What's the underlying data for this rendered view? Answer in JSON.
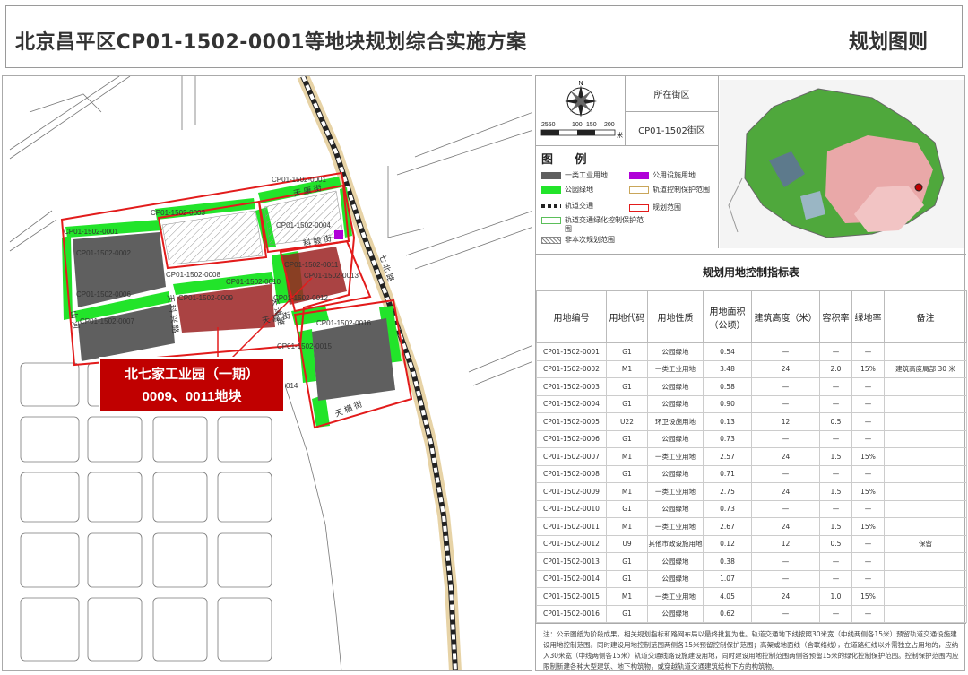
{
  "header": {
    "title": "北京昌平区CP01-1502-0001等地块规划综合实施方案",
    "right": "规划图则"
  },
  "colors": {
    "industrial": "#5f5f5f",
    "green": "#22e42a",
    "public": "#b000d8",
    "boundary": "#e21b1b",
    "highlight": "#9b2222",
    "label_bg": "#c00000"
  },
  "map": {
    "callout": [
      "北七家工业园（一期）",
      "0009、0011地块"
    ],
    "parcel_labels": [
      "CP01-1502-0001",
      "CP01-1502-0002",
      "CP01-1502-0003",
      "CP01-1502-0004",
      "CP01-1502-0005",
      "CP01-1502-0006",
      "CP01-1502-0007",
      "CP01-1502-0008",
      "CP01-1502-0009",
      "CP01-1502-0010",
      "CP01-1502-0011",
      "CP01-1502-0012",
      "CP01-1502-0013",
      "CP01-1502-0015",
      "CP01-1502-0016",
      "02-0014"
    ],
    "road_labels": {
      "tiankang": "天 康 街",
      "keyi": "科 毅 街",
      "kexing": "天 科 兴 路",
      "tianjin": "天 津 路",
      "shanhe": "山 河",
      "tianjiajie": "天 嘉 街",
      "qibei": "七 北 路",
      "tianheng": "天 横 街"
    }
  },
  "compass": {
    "north": "N",
    "scale": [
      "2550",
      "100",
      "150",
      "200"
    ],
    "unit": "米"
  },
  "district": {
    "label": "所在街区",
    "value": "CP01-1502街区"
  },
  "legend": {
    "title": "图 例",
    "items": {
      "industrial": "一类工业用地",
      "public": "公用设施用地",
      "park": "公园绿地",
      "rail_protect": "轨道控制保护范围",
      "rail": "轨道交通",
      "boundary": "规划范围",
      "green_protect": "轨道交通绿化控制保护范围",
      "excluded": "非本次规划范围"
    }
  },
  "table": {
    "title": "规划用地控制指标表",
    "headers": [
      "用地编号",
      "用地代码",
      "用地性质",
      "用地面积（公顷）",
      "建筑高度（米）",
      "容积率",
      "绿地率",
      "备注"
    ],
    "rows": [
      [
        "CP01-1502-0001",
        "G1",
        "公园绿地",
        "0.54",
        "—",
        "—",
        "—",
        ""
      ],
      [
        "CP01-1502-0002",
        "M1",
        "一类工业用地",
        "3.48",
        "24",
        "2.0",
        "15%",
        "建筑高度局部 30 米"
      ],
      [
        "CP01-1502-0003",
        "G1",
        "公园绿地",
        "0.58",
        "—",
        "—",
        "—",
        ""
      ],
      [
        "CP01-1502-0004",
        "G1",
        "公园绿地",
        "0.90",
        "—",
        "—",
        "—",
        ""
      ],
      [
        "CP01-1502-0005",
        "U22",
        "环卫设施用地",
        "0.13",
        "12",
        "0.5",
        "—",
        ""
      ],
      [
        "CP01-1502-0006",
        "G1",
        "公园绿地",
        "0.73",
        "—",
        "—",
        "—",
        ""
      ],
      [
        "CP01-1502-0007",
        "M1",
        "一类工业用地",
        "2.57",
        "24",
        "1.5",
        "15%",
        ""
      ],
      [
        "CP01-1502-0008",
        "G1",
        "公园绿地",
        "0.71",
        "—",
        "—",
        "—",
        ""
      ],
      [
        "CP01-1502-0009",
        "M1",
        "一类工业用地",
        "2.75",
        "24",
        "1.5",
        "15%",
        ""
      ],
      [
        "CP01-1502-0010",
        "G1",
        "公园绿地",
        "0.73",
        "—",
        "—",
        "—",
        ""
      ],
      [
        "CP01-1502-0011",
        "M1",
        "一类工业用地",
        "2.67",
        "24",
        "1.5",
        "15%",
        ""
      ],
      [
        "CP01-1502-0012",
        "U9",
        "其他市政设施用地",
        "0.12",
        "12",
        "0.5",
        "—",
        "保留"
      ],
      [
        "CP01-1502-0013",
        "G1",
        "公园绿地",
        "0.38",
        "—",
        "—",
        "—",
        ""
      ],
      [
        "CP01-1502-0014",
        "G1",
        "公园绿地",
        "1.07",
        "—",
        "—",
        "—",
        ""
      ],
      [
        "CP01-1502-0015",
        "M1",
        "一类工业用地",
        "4.05",
        "24",
        "1.0",
        "15%",
        ""
      ],
      [
        "CP01-1502-0016",
        "G1",
        "公园绿地",
        "0.62",
        "—",
        "—",
        "—",
        ""
      ]
    ]
  },
  "note": "注：公示图纸为阶段成果，相关规划指标和路网布局以最终批复为准。轨道交通地下线按照30米宽（中线两侧各15米）预留轨道交通设施建设用地控制范围。同时建设用地控制范围两侧各15米预留控制保护范围；高架或地面线（含联络线），在道路红线以外需独立占用地的，应纳入30米宽（中线两侧各15米）轨道交通线路设施建设用地，同时建设用地控制范围两侧各预留15米的绿化控制保护范围。控制保护范围内应限制新建各种大型建筑、地下构筑物，或穿越轨道交通建筑结构下方的构筑物。"
}
